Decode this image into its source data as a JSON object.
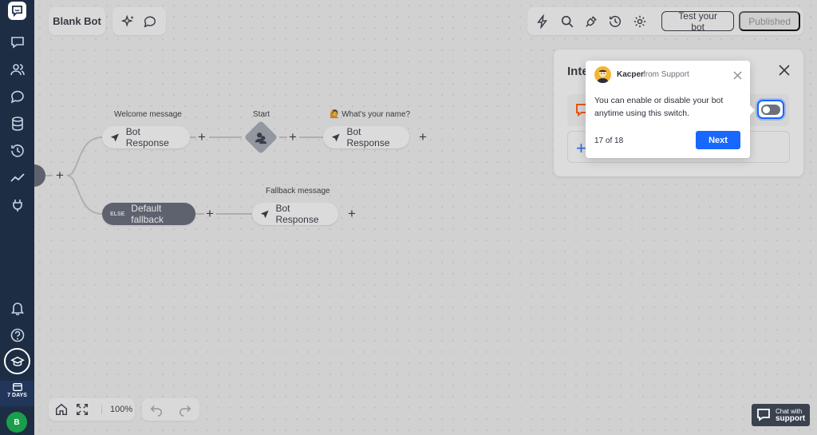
{
  "header": {
    "bot_name": "Blank Bot",
    "test_label": "Test your bot",
    "published_label": "Published"
  },
  "sidebar": {
    "trial_label": "7 DAYS",
    "avatar_initial": "B"
  },
  "flow": {
    "welcome_label": "Welcome message",
    "welcome_node": "Bot Response",
    "start_label": "Start",
    "name_label": "🙋 What's your name?",
    "name_node": "Bot Response",
    "fallback_tag": "ELSE",
    "fallback_node": "Default fallback",
    "fallback_msg_label": "Fallback message",
    "fallback_msg_node": "Bot Response"
  },
  "integrations": {
    "title_partial": "Inte"
  },
  "tooltip": {
    "author": "Kacper",
    "from": "from Support",
    "body": "You can enable or disable your bot anytime using this switch.",
    "step": "17 of 18",
    "next_label": "Next"
  },
  "bottom": {
    "zoom": "100%"
  },
  "chat_support": {
    "line1": "Chat with",
    "line2": "support"
  }
}
